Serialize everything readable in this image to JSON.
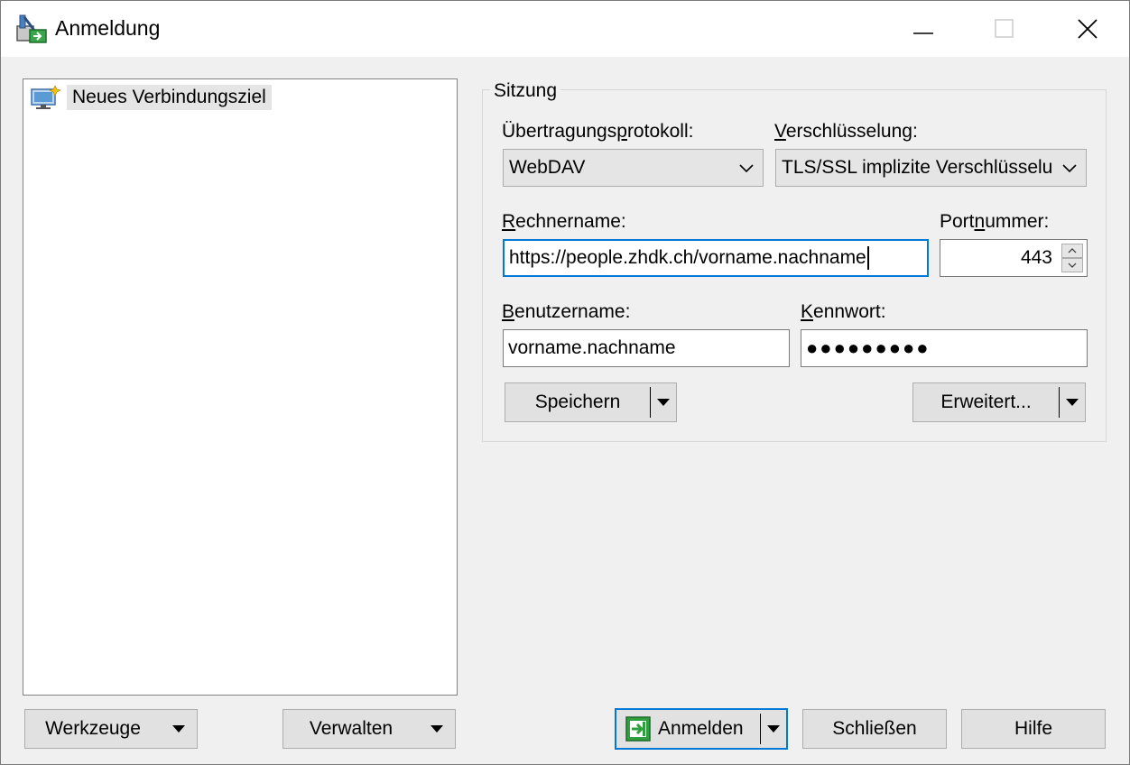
{
  "window": {
    "title": "Anmeldung"
  },
  "tree": {
    "items": [
      {
        "label": "Neues Verbindungsziel"
      }
    ]
  },
  "session": {
    "group_title": "Sitzung",
    "protocol": {
      "label_pre": "Übertragungs",
      "label_u": "p",
      "label_post": "rotokoll:",
      "value": "WebDAV"
    },
    "encryption": {
      "label_pre": "",
      "label_u": "V",
      "label_post": "erschlüsselung:",
      "value": "TLS/SSL implizite Verschlüsselung"
    },
    "host": {
      "label_pre": "",
      "label_u": "R",
      "label_post": "echnername:",
      "value": "https://people.zhdk.ch/vorname.nachname"
    },
    "port": {
      "label_pre": "Port",
      "label_u": "n",
      "label_post": "ummer:",
      "value": "443"
    },
    "username": {
      "label_pre": "",
      "label_u": "B",
      "label_post": "enutzername:",
      "value": "vorname.nachname"
    },
    "password": {
      "label_pre": "",
      "label_u": "K",
      "label_post": "ennwort:",
      "value": "●●●●●●●●●"
    },
    "save_label": "Speichern",
    "advanced_label": "Erweitert..."
  },
  "footer": {
    "tools_label": "Werkzeuge",
    "manage_label": "Verwalten",
    "login_label": "Anmelden",
    "close_label": "Schließen",
    "help_label": "Hilfe"
  }
}
